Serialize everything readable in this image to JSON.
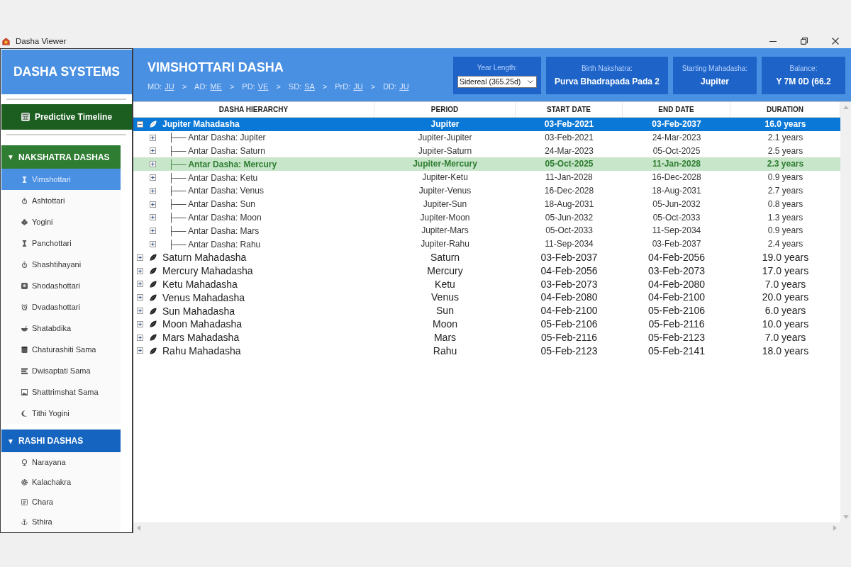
{
  "window": {
    "title": "Dasha Viewer"
  },
  "sidebar": {
    "title": "DASHA SYSTEMS",
    "timeline_button": {
      "label": "Predictive Timeline"
    },
    "groups": [
      {
        "label": "NAKSHATRA DASHAS",
        "arrow": "▼",
        "expanded": true,
        "color": "#2e7d32",
        "items": [
          {
            "label": "Vimshottari",
            "selected": true
          },
          {
            "label": "Ashtottari",
            "selected": false
          },
          {
            "label": "Yogini",
            "selected": false
          },
          {
            "label": "Panchottari",
            "selected": false
          },
          {
            "label": "Shashtihayani",
            "selected": false
          },
          {
            "label": "Shodashottari",
            "selected": false
          },
          {
            "label": "Dvadashottari",
            "selected": false
          },
          {
            "label": "Shatabdika",
            "selected": false
          },
          {
            "label": "Chaturashiti Sama",
            "selected": false
          },
          {
            "label": "Dwisaptati Sama",
            "selected": false
          },
          {
            "label": "Shattrimshat Sama",
            "selected": false
          },
          {
            "label": "Tithi Yogini",
            "selected": false
          }
        ]
      },
      {
        "label": "RASHI DASHAS",
        "arrow": "▼",
        "expanded": true,
        "color": "#1565c0",
        "items": [
          {
            "label": "Narayana",
            "selected": false
          },
          {
            "label": "Kalachakra",
            "selected": false
          },
          {
            "label": "Chara",
            "selected": false
          },
          {
            "label": "Sthira",
            "selected": false
          }
        ]
      }
    ]
  },
  "header": {
    "title": "VIMSHOTTARI DASHA",
    "breadcrumb": [
      {
        "label": "MD:",
        "value": "JU"
      },
      {
        "separator": ">",
        "label": "AD:",
        "value": "ME"
      },
      {
        "separator": ">",
        "label": "PD:",
        "value": "VE"
      },
      {
        "separator": ">",
        "label": "SD:",
        "value": "SA"
      },
      {
        "separator": ">",
        "label": "PrD:",
        "value": "JU"
      },
      {
        "separator": ">",
        "label": "DD:",
        "value": "JU"
      }
    ],
    "cards": [
      {
        "kind": "select",
        "label": "Year Length:",
        "value": "Sidereal (365.25d)"
      },
      {
        "kind": "text",
        "label": "Birth Nakshatra:",
        "value": "Purva Bhadrapada Pada 2"
      },
      {
        "kind": "text",
        "label": "Starting Mahadasha:",
        "value": "Jupiter"
      },
      {
        "kind": "text",
        "label": "Balance:",
        "value": "Y 7M 0D (66.2"
      }
    ]
  },
  "table": {
    "columns": [
      "DASHA HIERARCHY",
      "PERIOD",
      "START DATE",
      "END DATE",
      "DURATION"
    ],
    "rows": [
      {
        "name": "Jupiter Mahadasha",
        "period": "Jupiter",
        "start": "03-Feb-2021",
        "end": "03-Feb-2037",
        "duration": "16.0 years",
        "expanded": true,
        "selected": true,
        "current": false,
        "children": [
          {
            "name": "├── Antar Dasha: Jupiter",
            "period": "Jupiter-Jupiter",
            "start": "03-Feb-2021",
            "end": "24-Mar-2023",
            "duration": "2.1 years",
            "expanded": false,
            "selected": false,
            "current": false
          },
          {
            "name": "├── Antar Dasha: Saturn",
            "period": "Jupiter-Saturn",
            "start": "24-Mar-2023",
            "end": "05-Oct-2025",
            "duration": "2.5 years",
            "expanded": false,
            "selected": false,
            "current": false
          },
          {
            "name": "├── Antar Dasha: Mercury",
            "period": "Jupiter-Mercury",
            "start": "05-Oct-2025",
            "end": "11-Jan-2028",
            "duration": "2.3 years",
            "expanded": false,
            "selected": false,
            "current": true
          },
          {
            "name": "├── Antar Dasha: Ketu",
            "period": "Jupiter-Ketu",
            "start": "11-Jan-2028",
            "end": "16-Dec-2028",
            "duration": "0.9 years",
            "expanded": false,
            "selected": false,
            "current": false
          },
          {
            "name": "├── Antar Dasha: Venus",
            "period": "Jupiter-Venus",
            "start": "16-Dec-2028",
            "end": "18-Aug-2031",
            "duration": "2.7 years",
            "expanded": false,
            "selected": false,
            "current": false
          },
          {
            "name": "├── Antar Dasha: Sun",
            "period": "Jupiter-Sun",
            "start": "18-Aug-2031",
            "end": "05-Jun-2032",
            "duration": "0.8 years",
            "expanded": false,
            "selected": false,
            "current": false
          },
          {
            "name": "├── Antar Dasha: Moon",
            "period": "Jupiter-Moon",
            "start": "05-Jun-2032",
            "end": "05-Oct-2033",
            "duration": "1.3 years",
            "expanded": false,
            "selected": false,
            "current": false
          },
          {
            "name": "├── Antar Dasha: Mars",
            "period": "Jupiter-Mars",
            "start": "05-Oct-2033",
            "end": "11-Sep-2034",
            "duration": "0.9 years",
            "expanded": false,
            "selected": false,
            "current": false
          },
          {
            "name": "├── Antar Dasha: Rahu",
            "period": "Jupiter-Rahu",
            "start": "11-Sep-2034",
            "end": "03-Feb-2037",
            "duration": "2.4 years",
            "expanded": false,
            "selected": false,
            "current": false
          }
        ]
      },
      {
        "name": "Saturn Mahadasha",
        "period": "Saturn",
        "start": "03-Feb-2037",
        "end": "04-Feb-2056",
        "duration": "19.0 years",
        "expanded": false,
        "selected": false,
        "current": false
      },
      {
        "name": "Mercury Mahadasha",
        "period": "Mercury",
        "start": "04-Feb-2056",
        "end": "03-Feb-2073",
        "duration": "17.0 years",
        "expanded": false,
        "selected": false,
        "current": false
      },
      {
        "name": "Ketu Mahadasha",
        "period": "Ketu",
        "start": "03-Feb-2073",
        "end": "04-Feb-2080",
        "duration": "7.0 years",
        "expanded": false,
        "selected": false,
        "current": false
      },
      {
        "name": "Venus Mahadasha",
        "period": "Venus",
        "start": "04-Feb-2080",
        "end": "04-Feb-2100",
        "duration": "20.0 years",
        "expanded": false,
        "selected": false,
        "current": false
      },
      {
        "name": "Sun Mahadasha",
        "period": "Sun",
        "start": "04-Feb-2100",
        "end": "05-Feb-2106",
        "duration": "6.0 years",
        "expanded": false,
        "selected": false,
        "current": false
      },
      {
        "name": "Moon Mahadasha",
        "period": "Moon",
        "start": "05-Feb-2106",
        "end": "05-Feb-2116",
        "duration": "10.0 years",
        "expanded": false,
        "selected": false,
        "current": false
      },
      {
        "name": "Mars Mahadasha",
        "period": "Mars",
        "start": "05-Feb-2116",
        "end": "05-Feb-2123",
        "duration": "7.0 years",
        "expanded": false,
        "selected": false,
        "current": false
      },
      {
        "name": "Rahu Mahadasha",
        "period": "Rahu",
        "start": "05-Feb-2123",
        "end": "05-Feb-2141",
        "duration": "18.0 years",
        "expanded": false,
        "selected": false,
        "current": false
      }
    ]
  }
}
